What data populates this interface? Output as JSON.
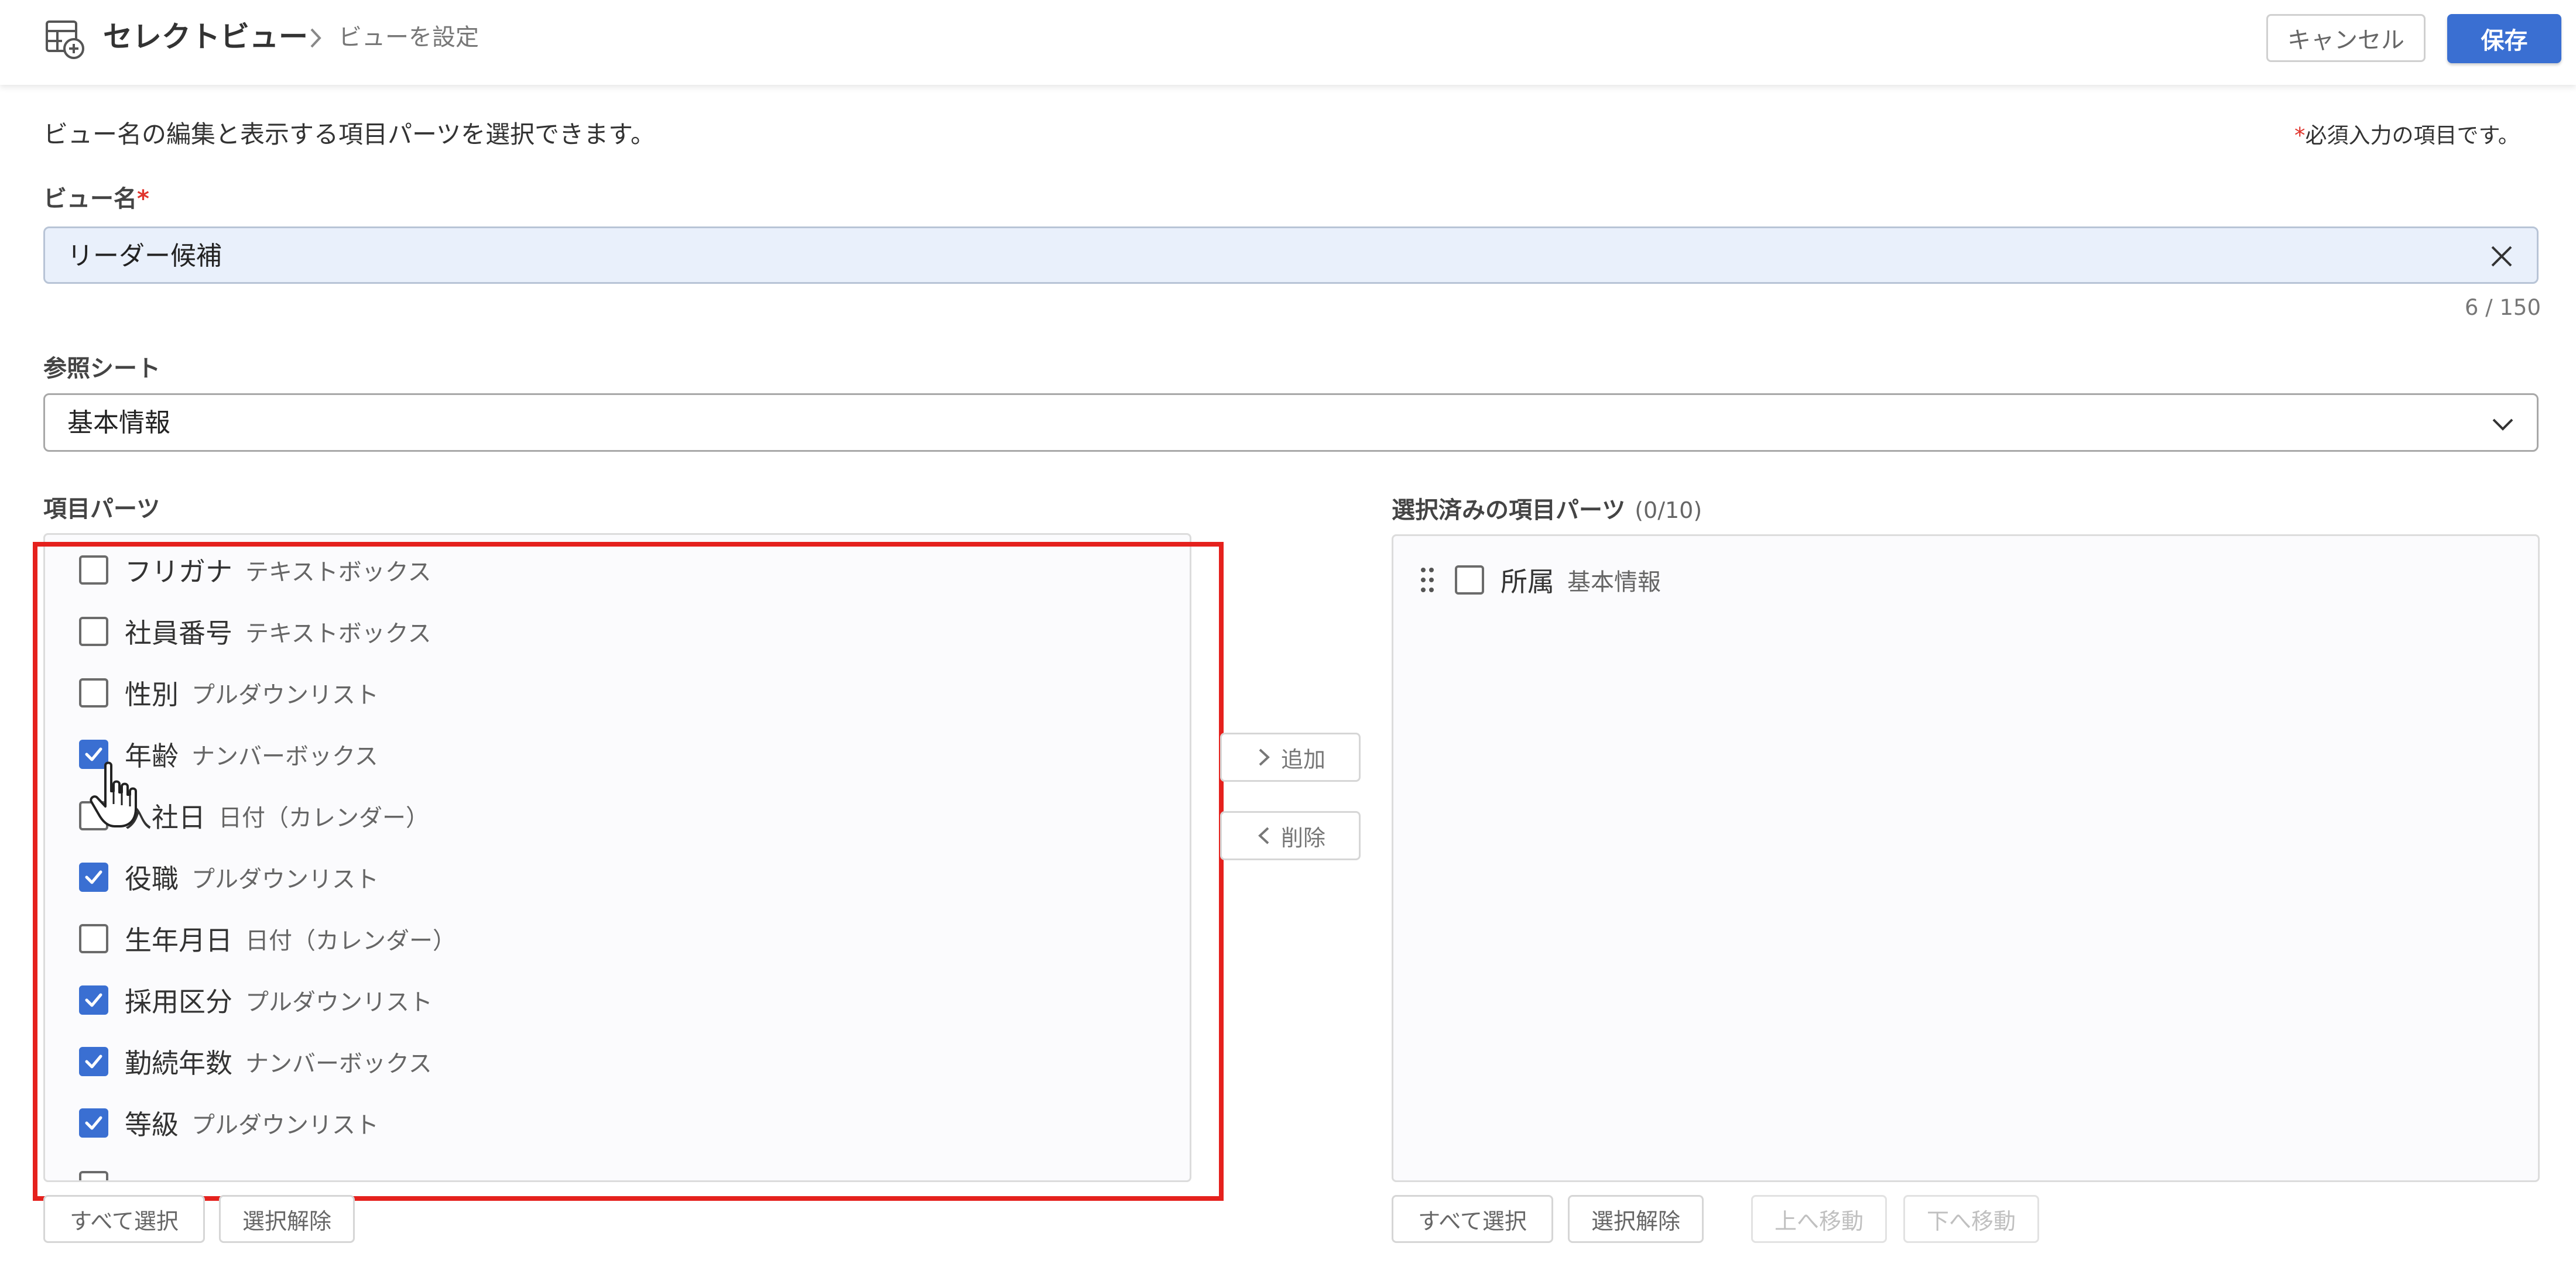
{
  "header": {
    "title": "セレクトビュー",
    "breadcrumb_current": "ビューを設定",
    "cancel_label": "キャンセル",
    "save_label": "保存"
  },
  "description": "ビュー名の編集と表示する項目パーツを選択できます。",
  "required_note": {
    "mark": "*",
    "text": "必須入力の項目です。"
  },
  "view_name": {
    "label": "ビュー名",
    "required_mark": "*",
    "value": "リーダー候補",
    "counter": "6 / 150"
  },
  "reference_sheet": {
    "label": "参照シート",
    "selected": "基本情報"
  },
  "parts": {
    "label": "項目パーツ",
    "items": [
      {
        "name": "フリガナ",
        "type": "テキストボックス",
        "checked": false
      },
      {
        "name": "社員番号",
        "type": "テキストボックス",
        "checked": false
      },
      {
        "name": "性別",
        "type": "プルダウンリスト",
        "checked": false
      },
      {
        "name": "年齢",
        "type": "ナンバーボックス",
        "checked": true
      },
      {
        "name": "入社日",
        "type": "日付（カレンダー）",
        "checked": false
      },
      {
        "name": "役職",
        "type": "プルダウンリスト",
        "checked": true
      },
      {
        "name": "生年月日",
        "type": "日付（カレンダー）",
        "checked": false
      },
      {
        "name": "採用区分",
        "type": "プルダウンリスト",
        "checked": true
      },
      {
        "name": "勤続年数",
        "type": "ナンバーボックス",
        "checked": true
      },
      {
        "name": "等級",
        "type": "プルダウンリスト",
        "checked": true
      }
    ],
    "select_all_label": "すべて選択",
    "deselect_label": "選択解除"
  },
  "transfer": {
    "add_label": "追加",
    "remove_label": "削除"
  },
  "selected": {
    "label": "選択済みの項目パーツ",
    "count": "(0/10)",
    "items": [
      {
        "name": "所属",
        "type": "基本情報",
        "checked": false
      }
    ],
    "select_all_label": "すべて選択",
    "deselect_label": "選択解除",
    "move_up_label": "上へ移動",
    "move_down_label": "下へ移動"
  },
  "colors": {
    "accent": "#3a6fd2",
    "highlight_border": "#e5211d",
    "required": "#e0342c",
    "input_bg": "#e9f0fb"
  }
}
